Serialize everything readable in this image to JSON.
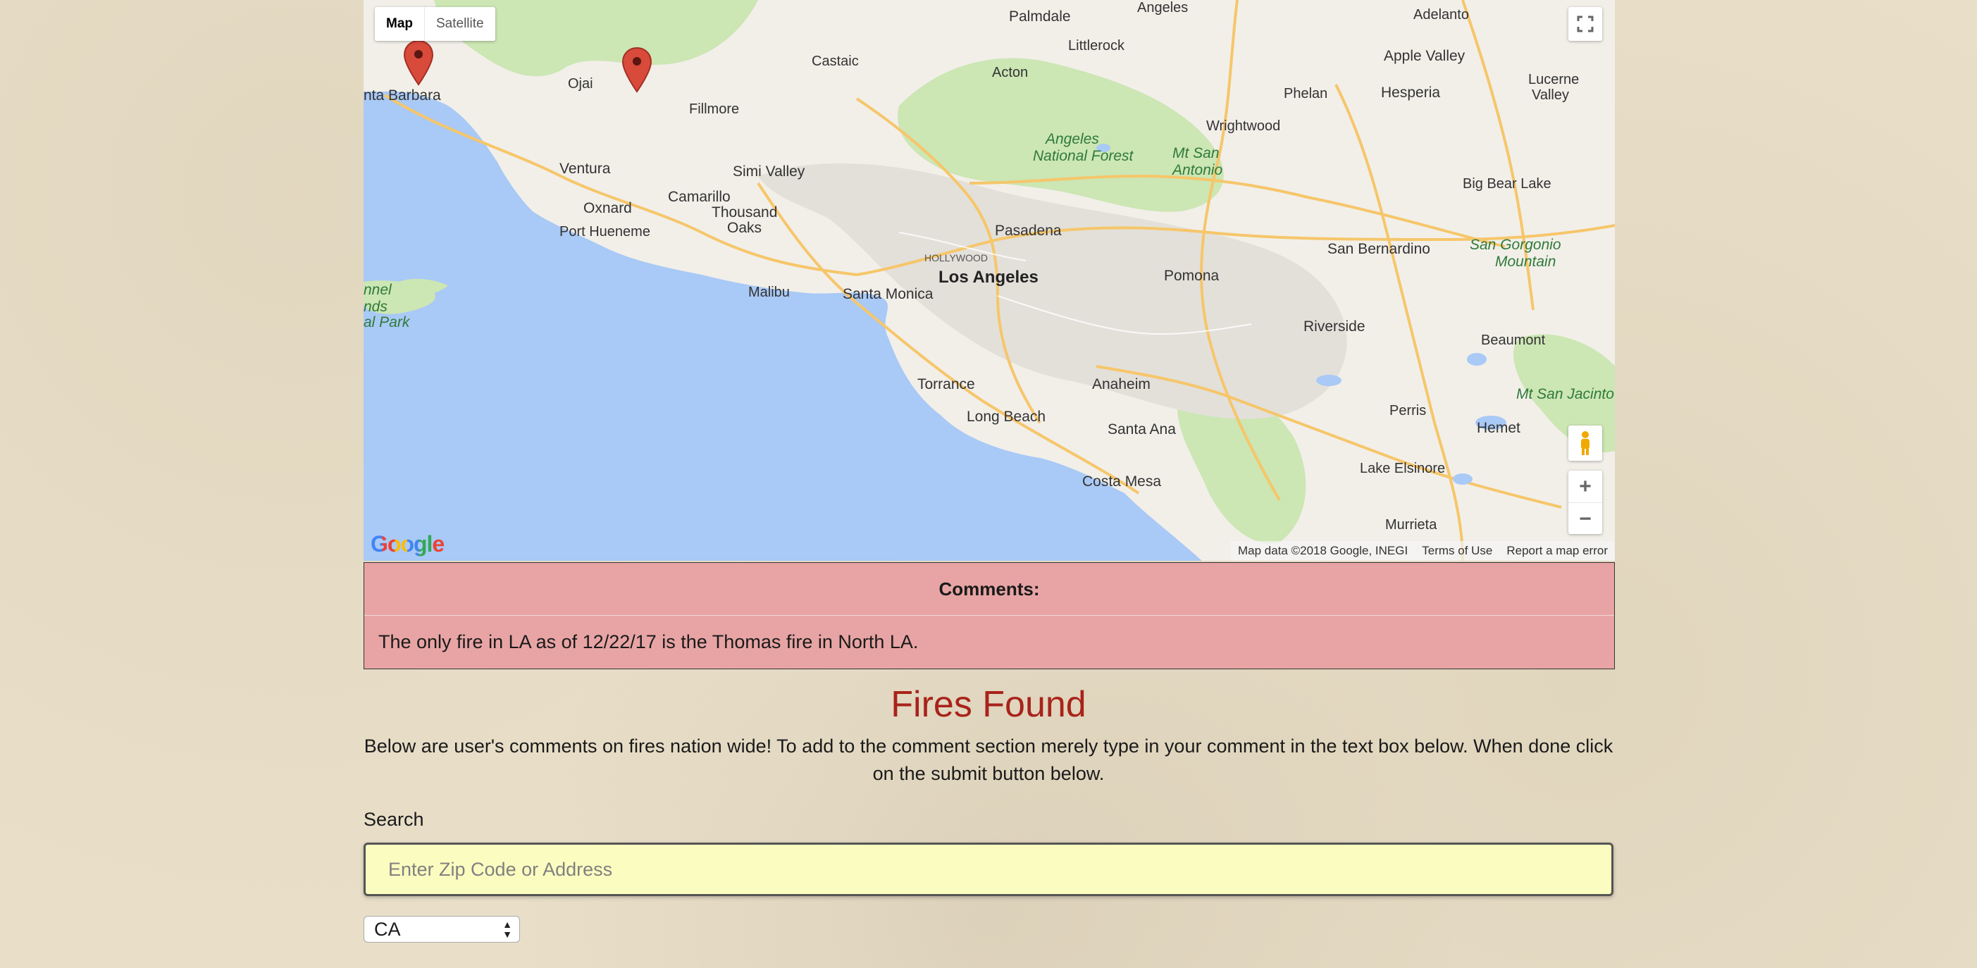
{
  "map": {
    "type_map_label": "Map",
    "type_satellite_label": "Satellite",
    "google_logo": "Google",
    "attribution": "Map data ©2018 Google, INEGI",
    "terms": "Terms of Use",
    "report": "Report a map error",
    "zoom_in": "+",
    "zoom_out": "−",
    "labels": {
      "palmdale": "Palmdale",
      "angeles_top": "Angeles",
      "adelanto": "Adelanto",
      "littlerock": "Littlerock",
      "apple_valley": "Apple Valley",
      "lucerne": "Lucerne",
      "valley": "Valley",
      "castaic": "Castaic",
      "acton": "Acton",
      "phelan": "Phelan",
      "hesperia": "Hesperia",
      "ojai": "Ojai",
      "fillmore": "Fillmore",
      "santa_barbara": "nta Barbara",
      "wrightwood": "Wrightwood",
      "angeles_nf_1": "Angeles",
      "angeles_nf_2": "National Forest",
      "mt_san_antonio_1": "Mt San",
      "mt_san_antonio_2": "Antonio",
      "ventura": "Ventura",
      "simi_valley": "Simi Valley",
      "big_bear_lake": "Big Bear Lake",
      "oxnard": "Oxnard",
      "camarillo": "Camarillo",
      "thousand_oaks_1": "Thousand",
      "thousand_oaks_2": "Oaks",
      "port_hueneme": "Port Hueneme",
      "pasadena": "Pasadena",
      "san_bernardino": "San Bernardino",
      "san_gorgonio_1": "San Gorgonio",
      "san_gorgonio_2": "Mountain",
      "hollywood": "HOLLYWOOD",
      "los_angeles": "Los Angeles",
      "pomona": "Pomona",
      "channel_1": "nnel",
      "channel_2": "nds",
      "channel_3": "al Park",
      "malibu": "Malibu",
      "santa_monica": "Santa Monica",
      "riverside": "Riverside",
      "beaumont": "Beaumont",
      "torrance": "Torrance",
      "anaheim": "Anaheim",
      "mt_san_jacinto": "Mt San Jacinto",
      "long_beach": "Long Beach",
      "perris": "Perris",
      "santa_ana": "Santa Ana",
      "hemet": "Hemet",
      "lake_elsinore": "Lake Elsinore",
      "costa_mesa": "Costa Mesa",
      "murrieta": "Murrieta"
    }
  },
  "comments": {
    "heading": "Comments:",
    "body": "The only fire in LA as of 12/22/17 is the Thomas fire in North LA."
  },
  "fires": {
    "title": "Fires Found",
    "intro": "Below are user's comments on fires nation wide! To add to the comment section merely type in your comment in the text box below. When done click on the submit button below."
  },
  "search": {
    "label": "Search",
    "placeholder": "Enter Zip Code or Address",
    "value": ""
  },
  "state_select": {
    "selected": "CA"
  },
  "colors": {
    "ocean": "#a9c9f6",
    "land": "#f2efe9",
    "park": "#cce6b4",
    "title_red": "#a8231a",
    "comments_bg": "#e8a4a4",
    "search_bg": "#fbfdc0",
    "marker": "#d84a3a"
  }
}
